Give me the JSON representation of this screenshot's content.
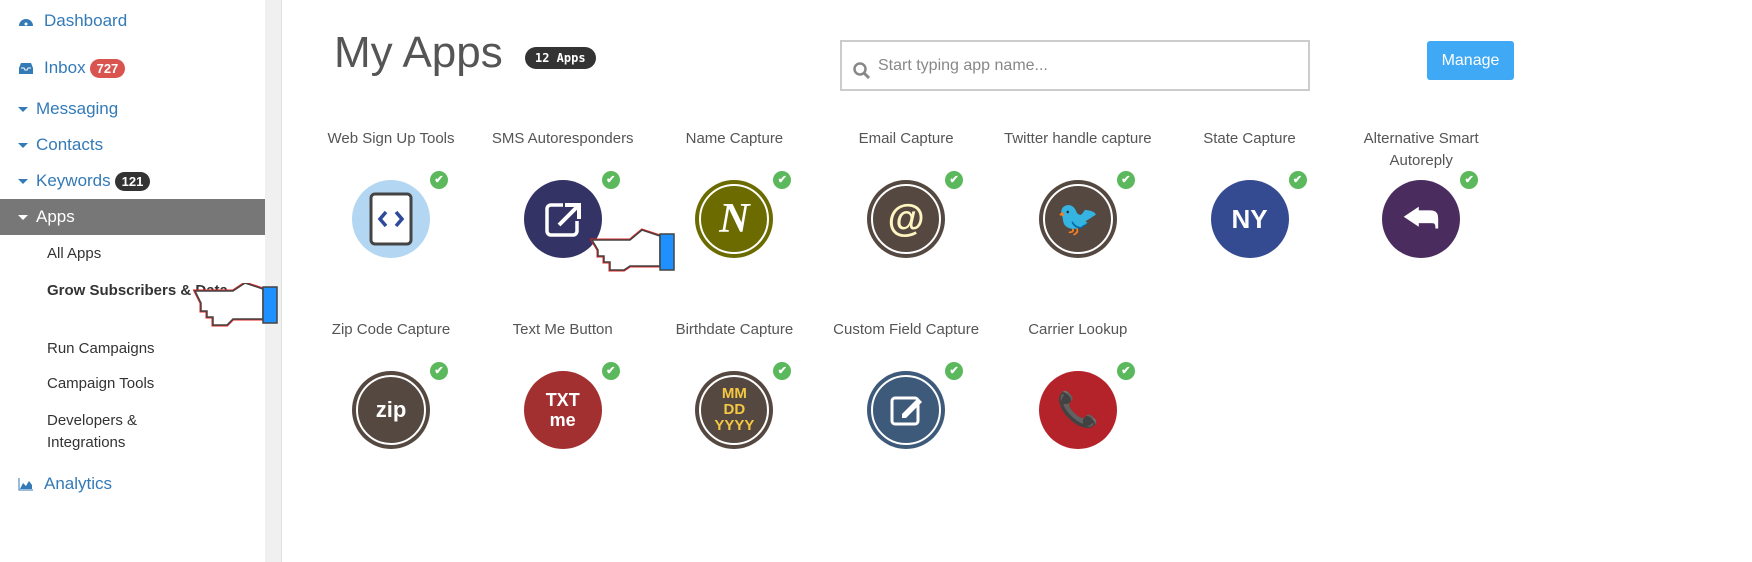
{
  "sidebar": {
    "dashboard": "Dashboard",
    "inbox": "Inbox",
    "inbox_badge": "727",
    "messaging": "Messaging",
    "contacts": "Contacts",
    "keywords": "Keywords",
    "keywords_badge": "121",
    "apps": "Apps",
    "sub": [
      "All Apps",
      "Grow Subscribers & Data",
      "Run Campaigns",
      "Campaign Tools",
      "Developers & Integrations"
    ],
    "analytics": "Analytics"
  },
  "header": {
    "title": "My Apps",
    "count": "12 Apps",
    "search_placeholder": "Start typing app name...",
    "manage": "Manage"
  },
  "apps": [
    {
      "name": "Web Sign Up Tools",
      "icon": "code-icon",
      "color": "#b3d7f2"
    },
    {
      "name": "SMS Autoresponders",
      "icon": "external-link-icon",
      "color": "#333366"
    },
    {
      "name": "Name Capture",
      "icon": "N",
      "color": "#6b6b00"
    },
    {
      "name": "Email Capture",
      "icon": "@",
      "color": "#544840"
    },
    {
      "name": "Twitter handle capture",
      "icon": "twitter-icon",
      "color": "#544840"
    },
    {
      "name": "State Capture",
      "icon": "NY",
      "color": "#354b91"
    },
    {
      "name": "Alternative Smart Autoreply",
      "icon": "reply-all-icon",
      "color": "#4a2d5e"
    },
    {
      "name": "Zip Code Capture",
      "icon": "zip",
      "color": "#544840"
    },
    {
      "name": "Text Me Button",
      "icon": "TXT me",
      "color": "#a33030"
    },
    {
      "name": "Birthdate Capture",
      "icon": "MM DD YYYY",
      "color": "#544840"
    },
    {
      "name": "Custom Field Capture",
      "icon": "edit-icon",
      "color": "#3e5a7a"
    },
    {
      "name": "Carrier Lookup",
      "icon": "phone-search-icon",
      "color": "#b5232a"
    }
  ]
}
